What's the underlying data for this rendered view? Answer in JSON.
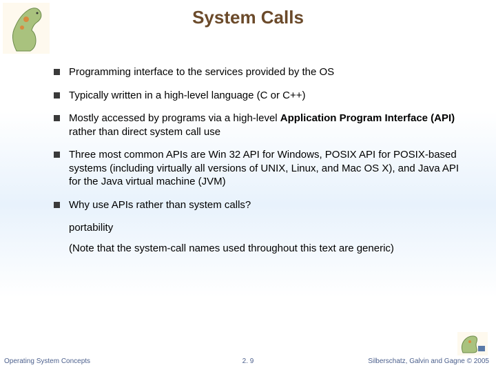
{
  "title": "System Calls",
  "bullets": {
    "b0": "Programming interface to the services provided by the OS",
    "b1": "Typically written in a high-level language (C or C++)",
    "b2_pre": "Mostly accessed by programs via a high-level ",
    "b2_bold": "Application Program Interface (API)",
    "b2_post": " rather than direct system call use",
    "b3": "Three most common APIs are Win 32 API for Windows, POSIX API for POSIX-based systems (including virtually all versions of UNIX, Linux, and Mac OS X), and Java API for the Java virtual machine (JVM)",
    "b4": "Why use APIs rather than system calls?",
    "sub0": "portability",
    "sub1": "(Note that the system-call names used throughout this text are generic)"
  },
  "footer": {
    "left": "Operating System Concepts",
    "center": "2. 9",
    "right": "Silberschatz, Galvin and Gagne © 2005"
  }
}
